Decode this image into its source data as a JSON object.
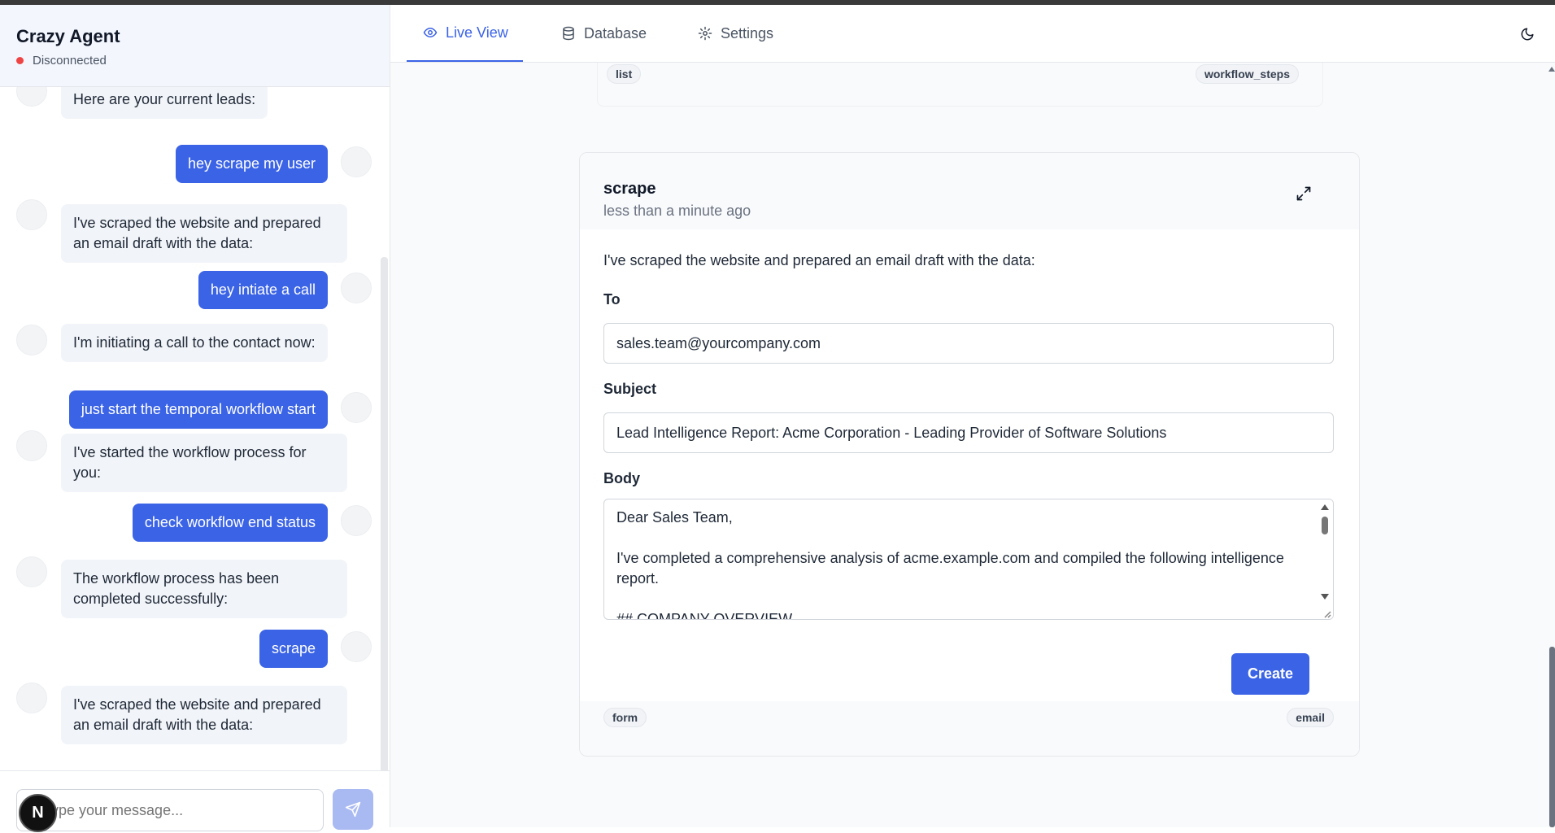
{
  "sidebar": {
    "title": "Crazy Agent",
    "status": "Disconnected",
    "status_color": "#ef4444",
    "messages": [
      {
        "role": "agent",
        "text": "Here are your current leads:"
      },
      {
        "role": "user",
        "text": "hey scrape my user"
      },
      {
        "role": "agent",
        "text": "I've scraped the website and prepared an email draft with the data:"
      },
      {
        "role": "user",
        "text": "hey intiate a call"
      },
      {
        "role": "agent",
        "text": "I'm initiating a call to the contact now:"
      },
      {
        "role": "user",
        "text": "just start the temporal workflow start"
      },
      {
        "role": "agent",
        "text": "I've started the workflow process for you:"
      },
      {
        "role": "user",
        "text": "check workflow end status"
      },
      {
        "role": "agent",
        "text": "The workflow process has been completed successfully:"
      },
      {
        "role": "user",
        "text": "scrape"
      },
      {
        "role": "agent",
        "text": "I've scraped the website and prepared an email draft with the data:"
      }
    ],
    "composer": {
      "placeholder": "Type your message...",
      "send_icon": "send-icon"
    },
    "badge": "N"
  },
  "tabs": [
    {
      "label": "Live View",
      "icon": "eye-icon",
      "active": true
    },
    {
      "label": "Database",
      "icon": "database-icon",
      "active": false
    },
    {
      "label": "Settings",
      "icon": "gear-icon",
      "active": false
    }
  ],
  "theme_toggle_icon": "moon-icon",
  "previous_card": {
    "tag_left": "list",
    "tag_right": "workflow_steps"
  },
  "card": {
    "title": "scrape",
    "timestamp": "less than a minute ago",
    "intro": "I've scraped the website and prepared an email draft with the data:",
    "to_label": "To",
    "to_value": "sales.team@yourcompany.com",
    "subject_label": "Subject",
    "subject_value": "Lead Intelligence Report: Acme Corporation - Leading Provider of Software Solutions",
    "body_label": "Body",
    "body_value": "Dear Sales Team,\n\nI've completed a comprehensive analysis of acme.example.com and compiled the following intelligence report.\n\n## COMPANY OVERVIEW",
    "create_label": "Create",
    "tag_left": "form",
    "tag_right": "email"
  },
  "colors": {
    "accent": "#3b63e6",
    "user_bubble": "#3b63e6",
    "agent_bubble": "#f1f4f8"
  }
}
